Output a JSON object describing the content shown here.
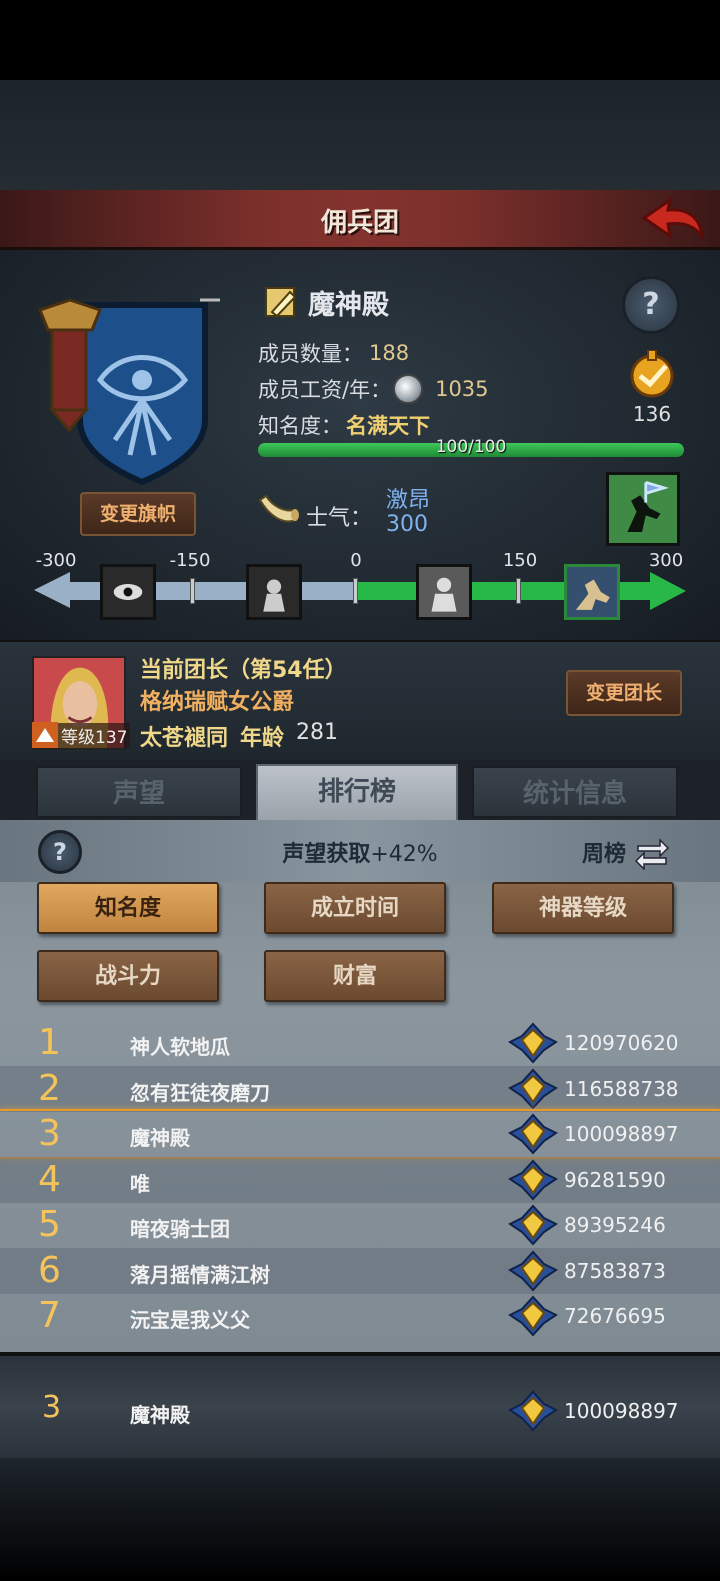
{
  "header": {
    "title": "佣兵团"
  },
  "guild": {
    "name": "魔神殿",
    "member_count_label": "成员数量：",
    "member_count": "188",
    "wage_label": "成员工资/年：",
    "wage": "1035",
    "fame_label": "知名度：",
    "fame_level": "名满天下",
    "fame_progress_text": "100/100",
    "fame_progress": 1.0,
    "gold_badge_value": "136",
    "change_flag_label": "变更旗帜",
    "morale_label": "士气：",
    "morale_state": "激昂",
    "morale_value": "300"
  },
  "morale_scale": {
    "labels": [
      "-300",
      "-150",
      "0",
      "150",
      "300"
    ]
  },
  "leader": {
    "title": "当前团长（第54任）",
    "name": "格纳瑞赋女公爵",
    "level": "等级137",
    "bloodline": "太苍褪同",
    "age_label": "年龄",
    "age": "281",
    "change_leader_label": "变更团长"
  },
  "tabs": [
    {
      "label": "声望",
      "active": false
    },
    {
      "label": "排行榜",
      "active": true
    },
    {
      "label": "统计信息",
      "active": false
    }
  ],
  "ranking": {
    "info_text": "声望获取",
    "info_pct": "+42%",
    "weekly_label": "周榜",
    "categories": [
      {
        "label": "知名度",
        "selected": true
      },
      {
        "label": "成立时间",
        "selected": false
      },
      {
        "label": "神器等级",
        "selected": false
      },
      {
        "label": "战斗力",
        "selected": false
      },
      {
        "label": "财富",
        "selected": false
      }
    ],
    "rows": [
      {
        "rank": "1",
        "name": "神人软地瓜",
        "score": "120970620"
      },
      {
        "rank": "2",
        "name": "忽有狂徒夜磨刀",
        "score": "116588738"
      },
      {
        "rank": "3",
        "name": "魔神殿",
        "score": "100098897"
      },
      {
        "rank": "4",
        "name": "唯",
        "score": "96281590"
      },
      {
        "rank": "5",
        "name": "暗夜骑士团",
        "score": "89395246"
      },
      {
        "rank": "6",
        "name": "落月摇情满江树",
        "score": "87583873"
      },
      {
        "rank": "7",
        "name": "沅宝是我义父",
        "score": "72676695"
      }
    ],
    "my_rank": {
      "rank": "3",
      "name": "魔神殿",
      "score": "100098897"
    }
  },
  "colors": {
    "accent_gold": "#f4c45a",
    "title_red": "#84332e",
    "morale_blue": "#7fb2f0",
    "fame_green": "#3ec85a"
  }
}
